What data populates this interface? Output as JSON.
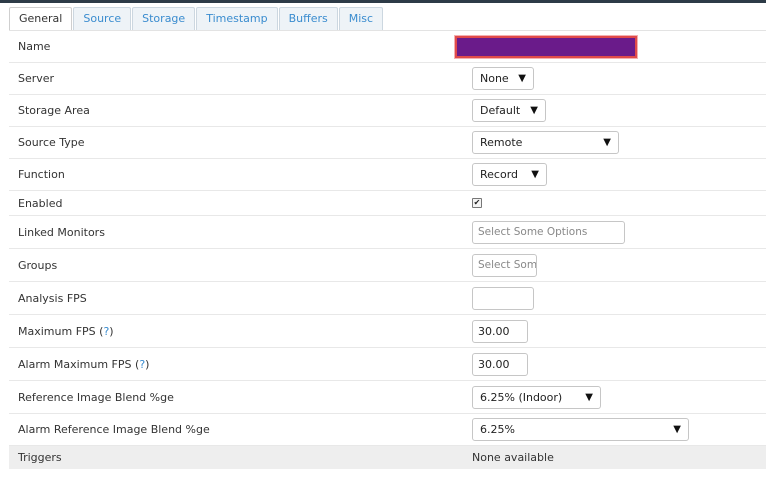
{
  "tabs": [
    {
      "label": "General",
      "active": true
    },
    {
      "label": "Source",
      "active": false
    },
    {
      "label": "Storage",
      "active": false
    },
    {
      "label": "Timestamp",
      "active": false
    },
    {
      "label": "Buffers",
      "active": false
    },
    {
      "label": "Misc",
      "active": false
    }
  ],
  "rows": {
    "name": {
      "label": "Name"
    },
    "server": {
      "label": "Server",
      "value": "None"
    },
    "storage_area": {
      "label": "Storage Area",
      "value": "Default"
    },
    "source_type": {
      "label": "Source Type",
      "value": "Remote"
    },
    "function": {
      "label": "Function",
      "value": "Record"
    },
    "enabled": {
      "label": "Enabled",
      "checked": true,
      "check_glyph": "✔"
    },
    "linked_monitors": {
      "label": "Linked Monitors",
      "placeholder": "Select Some Options"
    },
    "groups": {
      "label": "Groups",
      "placeholder": "Select Som"
    },
    "analysis_fps": {
      "label": "Analysis FPS",
      "value": ""
    },
    "maximum_fps": {
      "label": "Maximum FPS",
      "help_open": "(",
      "help_q": "?",
      "help_close": ")",
      "value": "30.00"
    },
    "alarm_maximum_fps": {
      "label": "Alarm Maximum FPS",
      "help_open": "(",
      "help_q": "?",
      "help_close": ")",
      "value": "30.00"
    },
    "ref_blend": {
      "label": "Reference Image Blend %ge",
      "value": "6.25% (Indoor)"
    },
    "alarm_ref_blend": {
      "label": "Alarm Reference Image Blend %ge",
      "value": "6.25%"
    },
    "triggers": {
      "label": "Triggers",
      "value": "None available"
    }
  },
  "caret_glyph": "▼",
  "colors": {
    "accent_link": "#3a8ccf",
    "redacted_fill": "#6a1b8a",
    "redacted_border": "#e04a4a"
  }
}
